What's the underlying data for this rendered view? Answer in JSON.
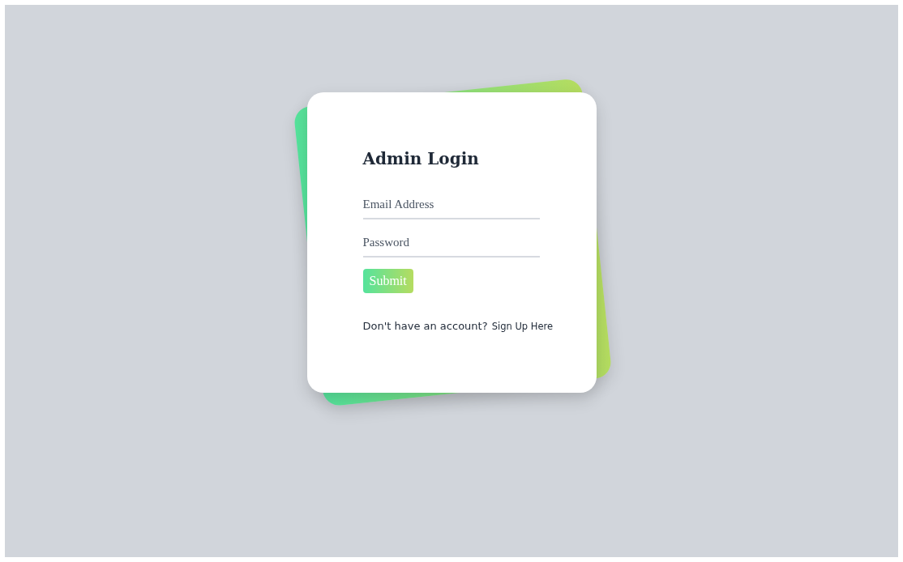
{
  "login_form": {
    "title": "Admin Login",
    "fields": [
      {
        "placeholder": "Email Address"
      },
      {
        "placeholder": "Password"
      }
    ],
    "submit_button": "Submit",
    "signup_prompt": {
      "text": "Don't have an account?",
      "link": "Sign Up Here"
    }
  }
}
